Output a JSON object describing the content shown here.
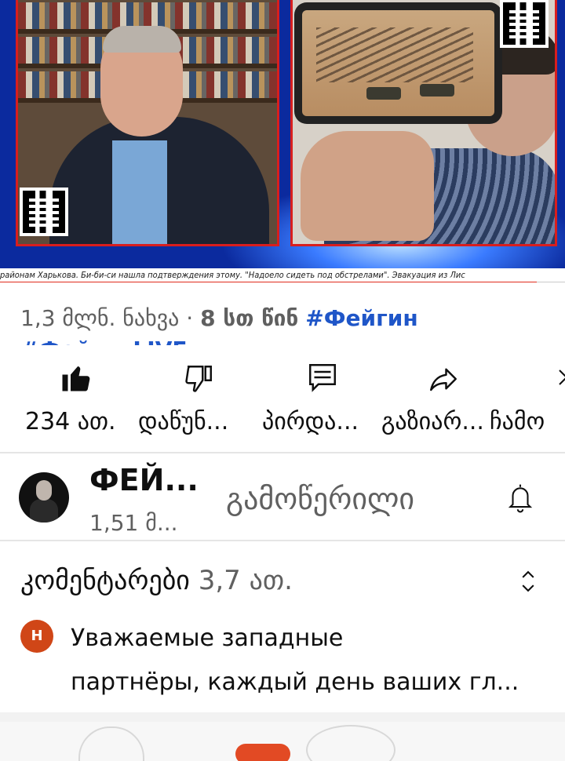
{
  "video": {
    "ticker_text": "районам Харькова. Би-би-си нашла подтверждения этому. \"Надоело сидеть под обстрелами\". Эвакуация из Лис",
    "progress_fraction": 0.95,
    "accent_red": "#e02a1c"
  },
  "meta": {
    "views": "1,3 მლნ. ნახვა",
    "separator": "·",
    "time_ago": "8 სთ წინ",
    "hashtag_1": "#Фейгин",
    "hashtag_2_partial": "#ФейгинLIVE"
  },
  "actions": {
    "like": {
      "icon": "thumbs-up-icon",
      "label": "234 ათ."
    },
    "dislike": {
      "icon": "thumbs-down-icon",
      "label": "დაწუნ..."
    },
    "comment": {
      "icon": "comment-icon",
      "label": "პირდა..."
    },
    "share": {
      "icon": "share-icon",
      "label": "გაზიარ..."
    },
    "download": {
      "icon": "download-icon",
      "label": "ჩამო"
    }
  },
  "channel": {
    "name": "ФЕЙ...",
    "subscribers": "1,51 მ...",
    "subscribe_state": "გამოწერილი",
    "bell_icon": "bell-icon"
  },
  "comments": {
    "title": "კომენტარები",
    "count": "3,7 ათ.",
    "sort_icon": "sort-icon",
    "top_comment": {
      "avatar_letter": "Н",
      "avatar_color": "#d04617",
      "line_1": "Уважаемые западные",
      "line_2": "партнёры, каждый день ваших гл..."
    }
  }
}
